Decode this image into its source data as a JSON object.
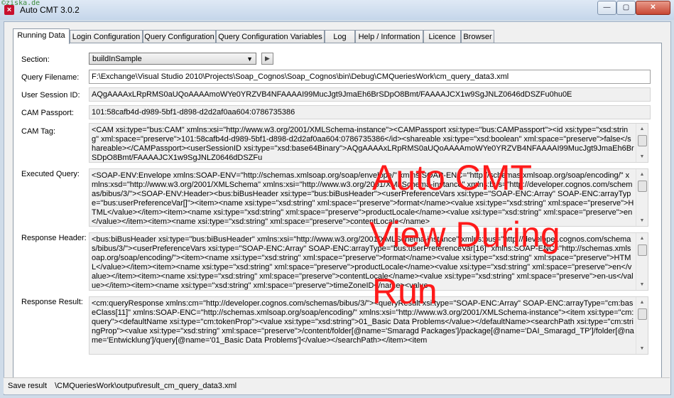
{
  "watermark": "©ziska.de",
  "window": {
    "title": "Auto CMT 3.0.2",
    "min": "—",
    "max": "▢",
    "close": "✕",
    "app_icon": "×"
  },
  "tabs": [
    "Running Data",
    "Login Configuration",
    "Query Configuration",
    "Query Configuration Variables",
    "Log",
    "Help / Information",
    "Licence",
    "Browser"
  ],
  "form": {
    "section_label": "Section:",
    "section_value": "buildInSample",
    "play_icon": "▶",
    "query_filename_label": "Query Filename:",
    "query_filename": "F:\\Exchange\\Visual Studio 2010\\Projects\\Soap_Cognos\\Soap_Cognos\\bin\\Debug\\CMQueriesWork\\cm_query_data3.xml",
    "user_session_label": "User Session ID:",
    "user_session": "AQgAAAAxLRpRMS0aUQoAAAAmoWYe0YRZVB4NFAAAAI99MucJgt9JmaEh6BrSDpO8Bmt/FAAAAJCX1w9SgJNLZ0646dDSZFu0hu0E",
    "cam_passport_label": "CAM Passport:",
    "cam_passport": "101:58cafb4d-d989-5bf1-d898-d2d2af0aa604:0786735386",
    "cam_tag_label": "CAM Tag:",
    "cam_tag": "<CAM xsi:type=\"bus:CAM\" xmlns:xsi=\"http://www.w3.org/2001/XMLSchema-instance\"><CAMPassport xsi:type=\"bus:CAMPassport\"><id xsi:type=\"xsd:string\" xml:space=\"preserve\">101:58cafb4d-d989-5bf1-d898-d2d2af0aa604:0786735386</id><shareable xsi:type=\"xsd:boolean\" xml:space=\"preserve\">false</shareable></CAMPassport><userSessionID xsi:type=\"xsd:base64Binary\">AQgAAAAxLRpRMS0aUQoAAAAmoWYe0YRZVB4NFAAAAI99MucJgt9JmaEh6BrSDpO8Bmt/FAAAAJCX1w9SgJNLZ0646dDSZFu",
    "executed_query_label": "Executed Query:",
    "executed_query": "<SOAP-ENV:Envelope xmlns:SOAP-ENV=\"http://schemas.xmlsoap.org/soap/envelope/\" xmlns:SOAP-ENC=\"http://schemas.xmlsoap.org/soap/encoding/\" xmlns:xsd=\"http://www.w3.org/2001/XMLSchema\" xmlns:xsi=\"http://www.w3.org/2001/XMLSchema-instance\" xmlns:bus=\"http://developer.cognos.com/schemas/bibus/3/\"><SOAP-ENV:Header><bus:biBusHeader xsi:type=\"bus:biBusHeader\"><userPreferenceVars xsi:type=\"SOAP-ENC:Array\" SOAP-ENC:arrayType=\"bus:userPreferenceVar[]\"><item><name xsi:type=\"xsd:string\" xml:space=\"preserve\">format</name><value xsi:type=\"xsd:string\" xml:space=\"preserve\">HTML</value></item><item><name xsi:type=\"xsd:string\" xml:space=\"preserve\">productLocale</name><value xsi:type=\"xsd:string\" xml:space=\"preserve\">en</value></item><item><name xsi:type=\"xsd:string\" xml:space=\"preserve\">contentLocale</name>",
    "response_header_label": "Response Header:",
    "response_header": "<bus:biBusHeader xsi:type=\"bus:biBusHeader\" xmlns:xsi=\"http://www.w3.org/2001/XMLSchema-instance\" xmlns:bus=\"http://developer.cognos.com/schemas/bibus/3/\"><userPreferenceVars xsi:type=\"SOAP-ENC:Array\" SOAP-ENC:arrayType=\"bus:userPreferenceVar[16]\" xmlns:SOAP-ENC=\"http://schemas.xmlsoap.org/soap/encoding/\"><item><name xsi:type=\"xsd:string\" xml:space=\"preserve\">format</name><value xsi:type=\"xsd:string\" xml:space=\"preserve\">HTML</value></item><item><name xsi:type=\"xsd:string\" xml:space=\"preserve\">productLocale</name><value xsi:type=\"xsd:string\" xml:space=\"preserve\">en</value></item><item><name xsi:type=\"xsd:string\" xml:space=\"preserve\">contentLocale</name><value xsi:type=\"xsd:string\" xml:space=\"preserve\">en-us</value></item><item><name xsi:type=\"xsd:string\" xml:space=\"preserve\">timeZoneID</name><value",
    "response_result_label": "Response Result:",
    "response_result": "<cm:queryResponse xmlns:cm=\"http://developer.cognos.com/schemas/bibus/3/\"><queryResult xsi:type=\"SOAP-ENC:Array\" SOAP-ENC:arrayType=\"cm:baseClass[11]\" xmlns:SOAP-ENC=\"http://schemas.xmlsoap.org/soap/encoding/\" xmlns:xsi=\"http://www.w3.org/2001/XMLSchema-instance\"><item xsi:type=\"cm:query\"><defaultName xsi:type=\"cm:tokenProp\"><value xsi:type=\"xsd:string\">01_Basic Data Problems</value></defaultName><searchPath xsi:type=\"cm:stringProp\"><value xsi:type=\"xsd:string\" xml:space=\"preserve\">/content/folder[@name='Smaragd Packages']/package[@name='DAI_Smaragd_TP']/folder[@name='Entwicklung']/query[@name='01_Basic Data Problems']</value></searchPath></item><item"
  },
  "overlay": {
    "line1": "Auto CMT",
    "line2": "View During",
    "line3": "Run"
  },
  "status": {
    "label": "Save result",
    "path": "\\CMQueriesWork\\output\\result_cm_query_data3.xml"
  }
}
